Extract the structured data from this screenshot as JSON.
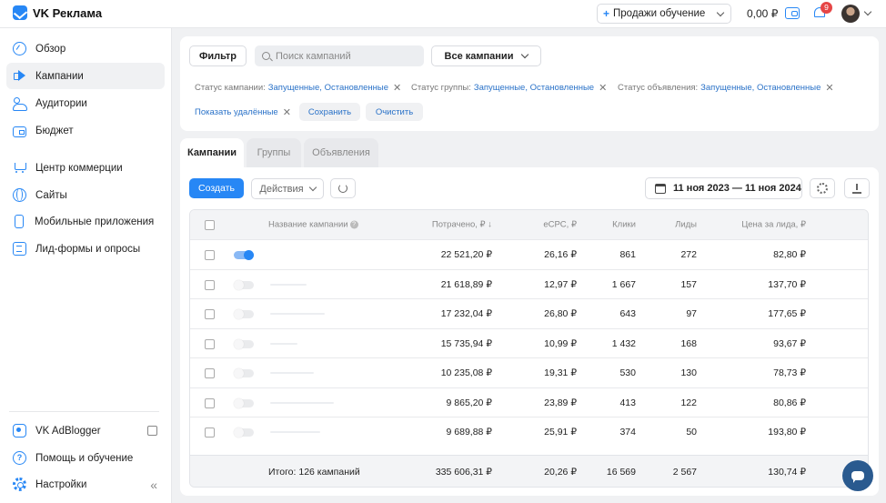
{
  "app": {
    "title": "VK Реклама"
  },
  "header": {
    "account_label": "Продажи обучение",
    "balance": "0,00 ₽",
    "notification_count": "9"
  },
  "sidebar": {
    "items": [
      {
        "label": "Обзор",
        "icon": "compass-icon"
      },
      {
        "label": "Кампании",
        "icon": "megaphone-icon",
        "active": true
      },
      {
        "label": "Аудитории",
        "icon": "users-icon"
      },
      {
        "label": "Бюджет",
        "icon": "wallet-icon"
      },
      {
        "label": "Центр коммерции",
        "icon": "cart-icon"
      },
      {
        "label": "Сайты",
        "icon": "globe-icon"
      },
      {
        "label": "Мобильные приложения",
        "icon": "phone-icon"
      },
      {
        "label": "Лид-формы и опросы",
        "icon": "form-icon"
      }
    ],
    "bottom_items": [
      {
        "label": "VK AdBlogger",
        "icon": "vk-icon"
      },
      {
        "label": "Помощь и обучение",
        "icon": "help-icon"
      },
      {
        "label": "Настройки",
        "icon": "gear-icon"
      }
    ]
  },
  "filters": {
    "filter_button": "Фильтр",
    "search_placeholder": "Поиск кампаний",
    "scope_select": "Все кампании",
    "chips": [
      {
        "label": "Статус кампании:",
        "value": "Запущенные, Остановленные"
      },
      {
        "label": "Статус группы:",
        "value": "Запущенные, Остановленные"
      },
      {
        "label": "Статус объявления:",
        "value": "Запущенные, Остановленные"
      }
    ],
    "show_deleted": "Показать удалённые",
    "save": "Сохранить",
    "clear": "Очистить"
  },
  "tabs": [
    "Кампании",
    "Группы",
    "Объявления"
  ],
  "toolbar": {
    "create": "Создать",
    "actions": "Действия",
    "date_range": "11 ноя 2023 — 11 ноя 2024"
  },
  "table": {
    "columns": [
      "Название кампании",
      "Потрачено, ₽",
      "eCPC, ₽",
      "Клики",
      "Лиды",
      "Цена за лида, ₽"
    ],
    "rows": [
      {
        "spent": "22 521,20 ₽",
        "ecpc": "26,16 ₽",
        "clicks": "861",
        "leads": "272",
        "cpl": "82,80 ₽",
        "enabled": true
      },
      {
        "spent": "21 618,89 ₽",
        "ecpc": "12,97 ₽",
        "clicks": "1 667",
        "leads": "157",
        "cpl": "137,70 ₽",
        "enabled": false
      },
      {
        "spent": "17 232,04 ₽",
        "ecpc": "26,80 ₽",
        "clicks": "643",
        "leads": "97",
        "cpl": "177,65 ₽",
        "enabled": false
      },
      {
        "spent": "15 735,94 ₽",
        "ecpc": "10,99 ₽",
        "clicks": "1 432",
        "leads": "168",
        "cpl": "93,67 ₽",
        "enabled": false
      },
      {
        "spent": "10 235,08 ₽",
        "ecpc": "19,31 ₽",
        "clicks": "530",
        "leads": "130",
        "cpl": "78,73 ₽",
        "enabled": false
      },
      {
        "spent": "9 865,20 ₽",
        "ecpc": "23,89 ₽",
        "clicks": "413",
        "leads": "122",
        "cpl": "80,86 ₽",
        "enabled": false
      },
      {
        "spent": "9 689,88 ₽",
        "ecpc": "25,91 ₽",
        "clicks": "374",
        "leads": "50",
        "cpl": "193,80 ₽",
        "enabled": false
      }
    ],
    "totals": {
      "label": "Итого: 126 кампаний",
      "spent": "335 606,31 ₽",
      "ecpc": "20,26 ₽",
      "clicks": "16 569",
      "leads": "2 567",
      "cpl": "130,74 ₽"
    }
  },
  "colors": {
    "accent": "#2787f5",
    "link": "#2a72c8",
    "badge": "#e64646"
  }
}
